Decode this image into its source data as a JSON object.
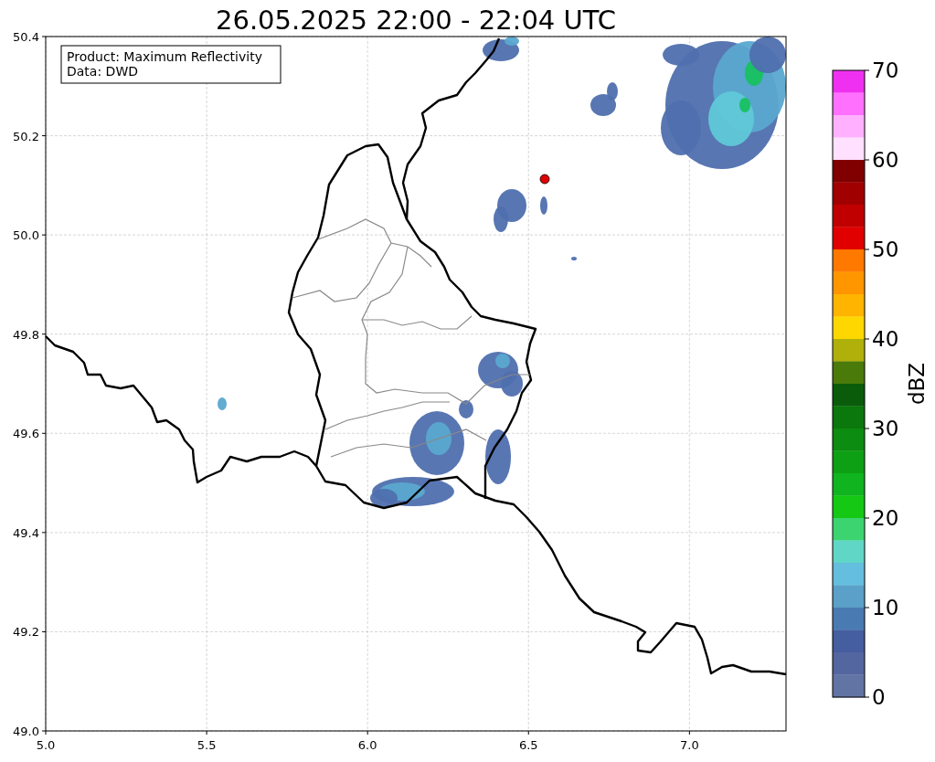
{
  "title": "26.05.2025 22:00 - 22:04 UTC",
  "info_box": [
    "Product: Maximum Reflectivity",
    "Data: DWD"
  ],
  "map": {
    "xticks": [
      "5.0",
      "5.5",
      "6.0",
      "6.5",
      "7.0"
    ],
    "yticks": [
      "50.4",
      "50.2",
      "50.0",
      "49.8",
      "49.6",
      "49.4",
      "49.2",
      "49.0"
    ]
  },
  "colorbar": {
    "label": "dBZ",
    "ticks": [
      "70",
      "60",
      "50",
      "40",
      "30",
      "20",
      "10",
      "0"
    ],
    "bands": [
      {
        "color": "#f030f0"
      },
      {
        "color": "#ff70ff"
      },
      {
        "color": "#ffb0ff"
      },
      {
        "color": "#ffe0ff"
      },
      {
        "color": "#800000"
      },
      {
        "color": "#a00000"
      },
      {
        "color": "#c00000"
      },
      {
        "color": "#e00000"
      },
      {
        "color": "#ff7800"
      },
      {
        "color": "#ff9600"
      },
      {
        "color": "#ffb400"
      },
      {
        "color": "#ffd700"
      },
      {
        "color": "#b0b00a"
      },
      {
        "color": "#4a7a0a"
      },
      {
        "color": "#0a5c0a"
      },
      {
        "color": "#0a780c"
      },
      {
        "color": "#0c8c10"
      },
      {
        "color": "#0ea014"
      },
      {
        "color": "#10b41e"
      },
      {
        "color": "#14c814"
      },
      {
        "color": "#3cd470"
      },
      {
        "color": "#60d6c6"
      },
      {
        "color": "#64bede"
      },
      {
        "color": "#5aa0c8"
      },
      {
        "color": "#4a7ab2"
      },
      {
        "color": "#455ea0"
      },
      {
        "color": "#5466a0"
      },
      {
        "color": "#6274a4"
      }
    ]
  }
}
